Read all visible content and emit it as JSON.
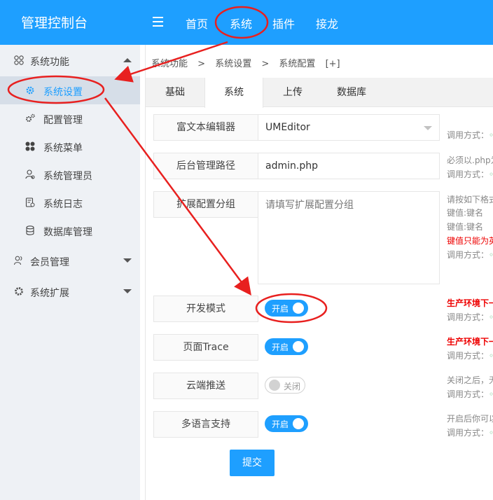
{
  "header": {
    "brand": "管理控制台",
    "nav": [
      "首页",
      "系统",
      "插件",
      "接龙"
    ]
  },
  "sidebar": {
    "groups": [
      {
        "label": "系统功能",
        "icon": "grid-icon",
        "expanded": true
      },
      {
        "label": "会员管理",
        "icon": "users-icon",
        "expanded": false
      },
      {
        "label": "系统扩展",
        "icon": "gear-icon",
        "expanded": false
      }
    ],
    "items": [
      {
        "label": "系统设置",
        "icon": "gear-icon",
        "active": true
      },
      {
        "label": "配置管理",
        "icon": "cogs-icon"
      },
      {
        "label": "系统菜单",
        "icon": "apps-icon"
      },
      {
        "label": "系统管理员",
        "icon": "admin-icon"
      },
      {
        "label": "系统日志",
        "icon": "log-icon"
      },
      {
        "label": "数据库管理",
        "icon": "database-icon"
      }
    ]
  },
  "breadcrumb": [
    "系统功能",
    ">",
    "系统设置",
    ">",
    "系统配置",
    "[+]"
  ],
  "tabs": [
    "基础",
    "系统",
    "上传",
    "数据库"
  ],
  "active_tab": "系统",
  "form": {
    "editor_label": "富文本编辑器",
    "editor_value": "UMEditor",
    "admin_path_label": "后台管理路径",
    "admin_path_value": "admin.php",
    "ext_group_label": "扩展配置分组",
    "ext_group_placeholder": "请填写扩展配置分组",
    "dev_mode_label": "开发模式",
    "dev_mode_state": "开启",
    "trace_label": "页面Trace",
    "trace_state": "开启",
    "cloud_label": "云端推送",
    "cloud_state": "关闭",
    "lang_label": "多语言支持",
    "lang_state": "开启",
    "submit": "提交"
  },
  "hints": {
    "call": "调用方式：",
    "admin_path": "必须以.php为",
    "ext_1": "请按如下格式",
    "ext_2": "键值:键名",
    "ext_3": "键值:键名",
    "ext_4": "键值只能为英",
    "dev": "生产环境下一",
    "trace": "生产环境下一",
    "cloud": "关闭之后，无",
    "lang": "开启后你可以"
  },
  "colors": {
    "primary": "#1E9FFF",
    "annotation": "#E8201F"
  }
}
